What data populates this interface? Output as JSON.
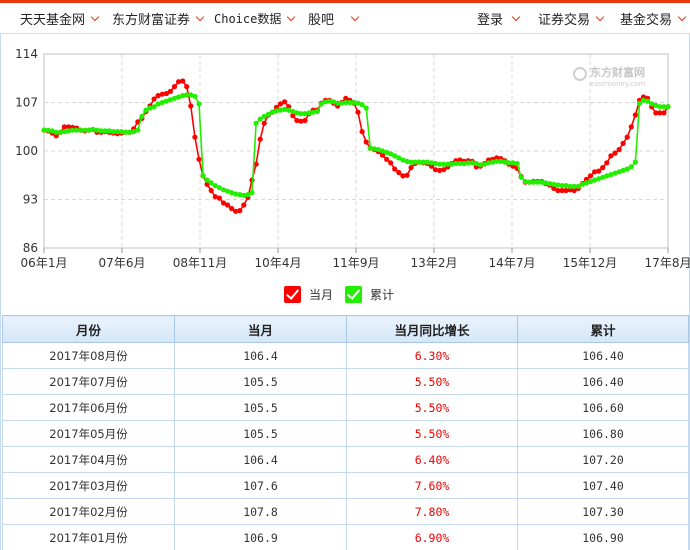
{
  "nav": {
    "left": [
      "天天基金网",
      "东方财富证券",
      "Choice数据",
      "股吧"
    ],
    "right": [
      "登录",
      "证券交易",
      "基金交易"
    ]
  },
  "chart_data": {
    "type": "line",
    "ylim": [
      86,
      114
    ],
    "yticks": [
      86,
      93,
      100,
      107,
      114
    ],
    "xticks": [
      "06年1月",
      "07年6月",
      "08年11月",
      "10年4月",
      "11年9月",
      "13年2月",
      "14年7月",
      "15年12月",
      "17年8月"
    ],
    "watermark": "东方财富网",
    "watermark_sub": "eastmoney.com",
    "series": [
      {
        "name": "当月",
        "color": "#ff0000",
        "values": [
          103.0,
          102.9,
          102.6,
          102.2,
          102.7,
          103.5,
          103.5,
          103.4,
          103.3,
          103.0,
          102.9,
          103.0,
          103.1,
          102.7,
          102.7,
          102.8,
          102.7,
          102.6,
          102.5,
          102.6,
          102.7,
          102.7,
          103.2,
          104.2,
          104.7,
          105.7,
          106.5,
          107.5,
          108.0,
          108.2,
          108.3,
          108.6,
          109.3,
          110.0,
          110.1,
          109.3,
          106.5,
          102.0,
          98.8,
          96.4,
          95.2,
          94.3,
          93.4,
          93.2,
          92.5,
          92.2,
          91.7,
          91.3,
          91.4,
          92.2,
          93.3,
          95.8,
          98.1,
          101.7,
          104.0,
          105.2,
          105.6,
          106.3,
          106.8,
          107.1,
          106.4,
          105.1,
          104.4,
          104.3,
          104.4,
          105.4,
          105.9,
          105.9,
          106.9,
          107.3,
          107.3,
          106.9,
          106.5,
          107.0,
          107.6,
          107.3,
          106.9,
          105.6,
          102.8,
          101.3,
          100.4,
          100.2,
          99.9,
          99.4,
          98.8,
          98.3,
          97.4,
          96.9,
          96.4,
          96.5,
          97.6,
          98.2,
          98.4,
          98.3,
          98.2,
          97.8,
          97.3,
          97.2,
          97.3,
          97.7,
          98.2,
          98.6,
          98.7,
          98.5,
          98.6,
          98.5,
          97.7,
          97.8,
          98.2,
          98.7,
          98.8,
          99.0,
          98.9,
          98.6,
          98.1,
          97.8,
          97.5,
          96.3,
          95.5,
          95.5,
          95.6,
          95.6,
          95.6,
          95.3,
          95.1,
          94.6,
          94.3,
          94.3,
          94.3,
          94.4,
          94.3,
          94.6,
          95.3,
          95.9,
          96.4,
          97.0,
          97.1,
          97.6,
          98.3,
          99.3,
          99.7,
          100.2,
          101.1,
          102.0,
          103.5,
          105.2,
          107.3,
          107.8,
          107.6,
          106.4,
          105.5,
          105.5,
          105.5,
          106.4
        ]
      },
      {
        "name": "累计",
        "color": "#22ee00",
        "values": [
          103.0,
          103.0,
          102.9,
          102.7,
          102.7,
          102.8,
          102.9,
          103.0,
          103.0,
          103.0,
          103.0,
          103.0,
          103.1,
          103.0,
          102.9,
          102.9,
          102.9,
          102.8,
          102.8,
          102.8,
          102.7,
          102.7,
          102.8,
          103.0,
          105.0,
          105.9,
          106.2,
          106.4,
          106.8,
          107.0,
          107.2,
          107.4,
          107.6,
          107.8,
          108.0,
          108.1,
          108.1,
          107.9,
          106.8,
          96.4,
          95.8,
          95.4,
          95.0,
          94.7,
          94.4,
          94.2,
          94.0,
          93.8,
          93.7,
          93.6,
          93.7,
          94.0,
          104.0,
          104.6,
          105.0,
          105.3,
          105.6,
          105.8,
          105.9,
          106.0,
          105.9,
          105.7,
          105.5,
          105.4,
          105.4,
          105.5,
          105.6,
          105.7,
          106.8,
          107.1,
          107.2,
          107.1,
          106.9,
          106.9,
          107.0,
          107.0,
          107.0,
          106.9,
          106.7,
          106.2,
          100.4,
          100.3,
          100.2,
          100.0,
          99.8,
          99.6,
          99.3,
          99.0,
          98.7,
          98.5,
          98.4,
          98.4,
          98.4,
          98.4,
          98.4,
          98.3,
          98.2,
          98.1,
          98.1,
          98.1,
          98.1,
          98.2,
          98.2,
          98.2,
          98.3,
          98.3,
          98.2,
          98.0,
          98.1,
          98.3,
          98.4,
          98.5,
          98.5,
          98.4,
          98.3,
          98.3,
          98.2,
          96.2,
          95.6,
          95.5,
          95.5,
          95.5,
          95.5,
          95.4,
          95.3,
          95.2,
          95.1,
          95.0,
          95.0,
          94.9,
          94.9,
          94.9,
          95.2,
          95.4,
          95.6,
          95.8,
          96.0,
          96.2,
          96.4,
          96.6,
          96.8,
          97.0,
          97.2,
          97.4,
          97.7,
          98.4,
          106.9,
          107.3,
          107.2,
          106.8,
          106.6,
          106.4,
          106.4,
          106.4
        ]
      }
    ]
  },
  "legend": [
    {
      "label": "当月",
      "color": "#ff0000"
    },
    {
      "label": "累计",
      "color": "#22ee00"
    }
  ],
  "table": {
    "headers": [
      "月份",
      "当月",
      "当月同比增长",
      "累计"
    ],
    "rows": [
      [
        "2017年08月份",
        "106.4",
        "6.30%",
        "106.40"
      ],
      [
        "2017年07月份",
        "105.5",
        "5.50%",
        "106.40"
      ],
      [
        "2017年06月份",
        "105.5",
        "5.50%",
        "106.60"
      ],
      [
        "2017年05月份",
        "105.5",
        "5.50%",
        "106.80"
      ],
      [
        "2017年04月份",
        "106.4",
        "6.40%",
        "107.20"
      ],
      [
        "2017年03月份",
        "107.6",
        "7.60%",
        "107.40"
      ],
      [
        "2017年02月份",
        "107.8",
        "7.80%",
        "107.30"
      ],
      [
        "2017年01月份",
        "106.9",
        "6.90%",
        "106.90"
      ]
    ]
  }
}
